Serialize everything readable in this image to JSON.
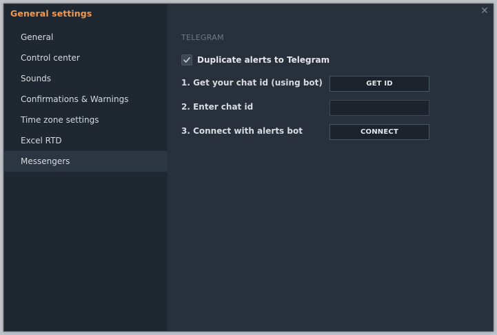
{
  "window": {
    "title": "General settings",
    "close_symbol": "✕"
  },
  "sidebar": {
    "items": [
      {
        "label": "General",
        "active": false
      },
      {
        "label": "Control center",
        "active": false
      },
      {
        "label": "Sounds",
        "active": false
      },
      {
        "label": "Confirmations & Warnings",
        "active": false
      },
      {
        "label": "Time zone settings",
        "active": false
      },
      {
        "label": "Excel RTD",
        "active": false
      },
      {
        "label": "Messengers",
        "active": true
      }
    ]
  },
  "telegram": {
    "section_title": "TELEGRAM",
    "duplicate_alerts": {
      "label": "Duplicate alerts to Telegram",
      "checked": true
    },
    "step1_label": "1. Get your chat id (using bot)",
    "get_id_button": "GET ID",
    "step2_label": "2. Enter chat id",
    "chat_id_value": "",
    "chat_id_placeholder": "",
    "step3_label": "3. Connect with alerts bot",
    "connect_button": "CONNECT"
  },
  "colors": {
    "accent": "#ee9a52",
    "sidebar_bg": "#1f2730",
    "content_bg": "#27303b",
    "active_item_bg": "#2c3542"
  },
  "icons": {
    "close": "close-icon",
    "check": "checkmark-icon"
  }
}
